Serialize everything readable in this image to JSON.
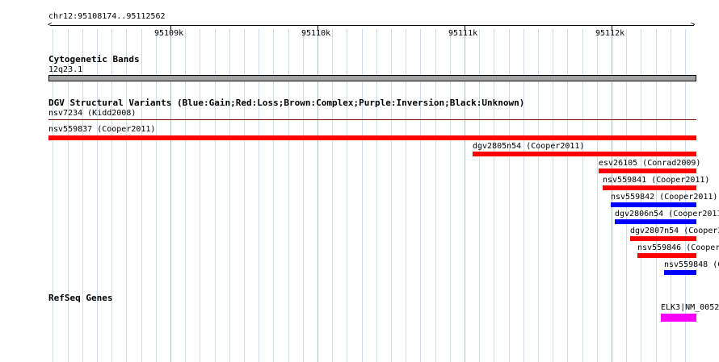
{
  "ruler": {
    "region_label": "chr12:95108174..95112562",
    "ticks": [
      "95109k",
      "95110k",
      "95111k",
      "95112k"
    ]
  },
  "tracks": {
    "cytoband": {
      "title": "Cytogenetic Bands",
      "band_label": "12q23.1",
      "band_color": "#a3a3a3"
    },
    "dgv": {
      "title": "DGV Structural Variants (Blue:Gain;Red:Loss;Brown:Complex;Purple:Inversion;Black:Unknown)",
      "colors": {
        "gain": "#0000ff",
        "loss": "#ff0000",
        "complex": "#8b4513",
        "inversion": "#800080",
        "unknown": "#000000"
      },
      "features": [
        {
          "label": "nsv7234 (Kidd2008)",
          "type": "inversion",
          "color": "#800000"
        },
        {
          "label": "nsv559837 (Cooper2011)",
          "type": "loss",
          "color": "#ff0000"
        },
        {
          "label": "dgv2805n54 (Cooper2011)",
          "type": "loss",
          "color": "#ff0000"
        },
        {
          "label": "esv26105 (Conrad2009)",
          "type": "loss",
          "color": "#ff0000"
        },
        {
          "label": "nsv559841 (Cooper2011)",
          "type": "loss",
          "color": "#ff0000"
        },
        {
          "label": "nsv559842 (Cooper2011)",
          "type": "gain",
          "color": "#0000ff"
        },
        {
          "label": "dgv2806n54 (Cooper2011",
          "type": "gain",
          "color": "#0000ff"
        },
        {
          "label": "dgv2807n54 (Cooper2",
          "type": "loss",
          "color": "#ff0000"
        },
        {
          "label": "nsv559846 (Cooper",
          "type": "loss",
          "color": "#ff0000"
        },
        {
          "label": "nsv559848 (C",
          "type": "gain",
          "color": "#0000ff"
        }
      ]
    },
    "refseq": {
      "title": "RefSeq Genes",
      "features": [
        {
          "label": "ELK3|NM_0052",
          "color": "#ff00ff"
        }
      ]
    }
  }
}
